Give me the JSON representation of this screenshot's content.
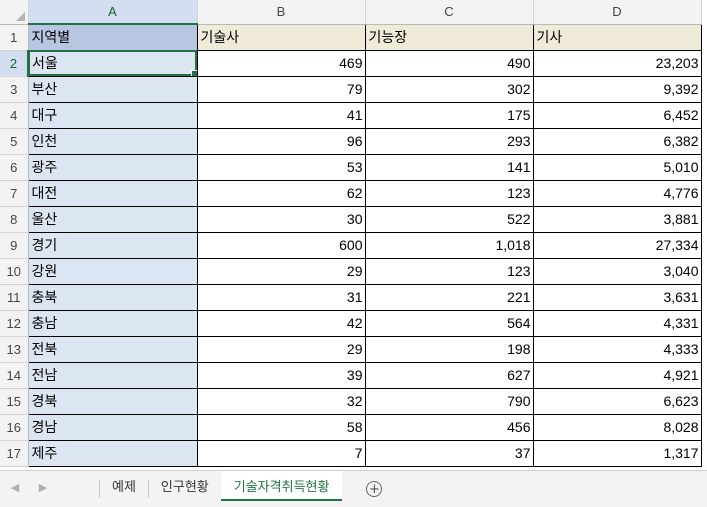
{
  "columns": [
    "A",
    "B",
    "C",
    "D"
  ],
  "row_numbers": [
    "1",
    "2",
    "3",
    "4",
    "5",
    "6",
    "7",
    "8",
    "9",
    "10",
    "11",
    "12",
    "13",
    "14",
    "15",
    "16",
    "17"
  ],
  "header": {
    "region": "지역별",
    "b": "기술사",
    "c": "기능장",
    "d": "기사"
  },
  "rows": [
    {
      "region": "서울",
      "b": "469",
      "c": "490",
      "d": "23,203"
    },
    {
      "region": "부산",
      "b": "79",
      "c": "302",
      "d": "9,392"
    },
    {
      "region": "대구",
      "b": "41",
      "c": "175",
      "d": "6,452"
    },
    {
      "region": "인천",
      "b": "96",
      "c": "293",
      "d": "6,382"
    },
    {
      "region": "광주",
      "b": "53",
      "c": "141",
      "d": "5,010"
    },
    {
      "region": "대전",
      "b": "62",
      "c": "123",
      "d": "4,776"
    },
    {
      "region": "울산",
      "b": "30",
      "c": "522",
      "d": "3,881"
    },
    {
      "region": "경기",
      "b": "600",
      "c": "1,018",
      "d": "27,334"
    },
    {
      "region": "강원",
      "b": "29",
      "c": "123",
      "d": "3,040"
    },
    {
      "region": "충북",
      "b": "31",
      "c": "221",
      "d": "3,631"
    },
    {
      "region": "충남",
      "b": "42",
      "c": "564",
      "d": "4,331"
    },
    {
      "region": "전북",
      "b": "29",
      "c": "198",
      "d": "4,333"
    },
    {
      "region": "전남",
      "b": "39",
      "c": "627",
      "d": "4,921"
    },
    {
      "region": "경북",
      "b": "32",
      "c": "790",
      "d": "6,623"
    },
    {
      "region": "경남",
      "b": "58",
      "c": "456",
      "d": "8,028"
    },
    {
      "region": "제주",
      "b": "7",
      "c": "37",
      "d": "1,317"
    }
  ],
  "tabs": [
    "예제",
    "인구현황",
    "기술자격취득현황"
  ],
  "nav": {
    "prev_icon": "◀",
    "next_icon": "▶",
    "add_icon": "+"
  },
  "accent_color": "#217346"
}
